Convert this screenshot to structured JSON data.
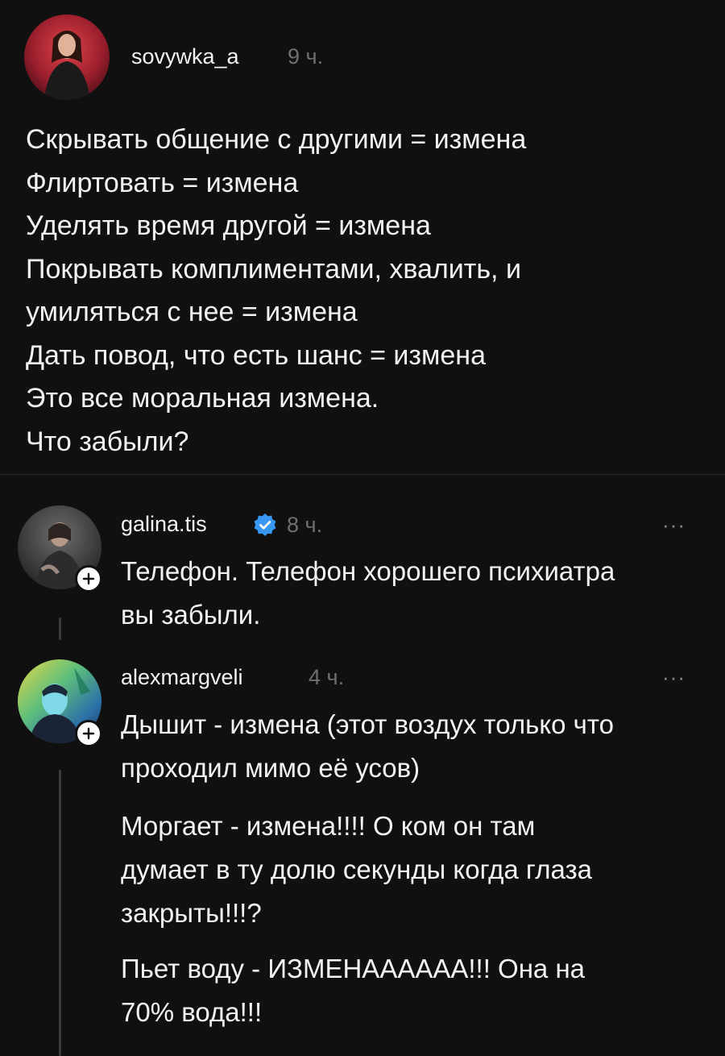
{
  "post": {
    "author": "sovywka_a",
    "time": "9 ч.",
    "lines": [
      "Скрывать общение с другими = измена",
      "Флиртовать = измена",
      "Уделять время другой = измена",
      "Покрывать комплиментами, хвалить, и",
      "умиляться с нее = измена",
      "Дать повод, что есть шанс = измена",
      "Это все моральная измена.",
      "Что забыли?"
    ]
  },
  "comments": [
    {
      "author": "galina.tis",
      "verified": true,
      "time": "8 ч.",
      "more": "···",
      "lines": [
        "Телефон. Телефон хорошего психиатра",
        "вы забыли."
      ]
    },
    {
      "author": "alexmargveli",
      "verified": false,
      "time": "4 ч.",
      "more": "···",
      "paragraphs": [
        [
          "Дышит - измена (этот воздух только что",
          "проходил мимо её усов)"
        ],
        [
          "Моргает - измена!!!! О ком он там",
          "думает в ту долю секунды когда глаза",
          "закрыты!!!?"
        ],
        [
          "Пьет воду - ИЗМЕНАААААА!!! Она на",
          "70% вода!!!"
        ]
      ]
    }
  ],
  "icons": {
    "follow": "plus-icon",
    "verified": "verified-check-icon",
    "more": "more-dots-icon"
  },
  "colors": {
    "background": "#101010",
    "text": "#f3f3f3",
    "muted": "#6f6f6f",
    "verified": "#3897f0"
  }
}
